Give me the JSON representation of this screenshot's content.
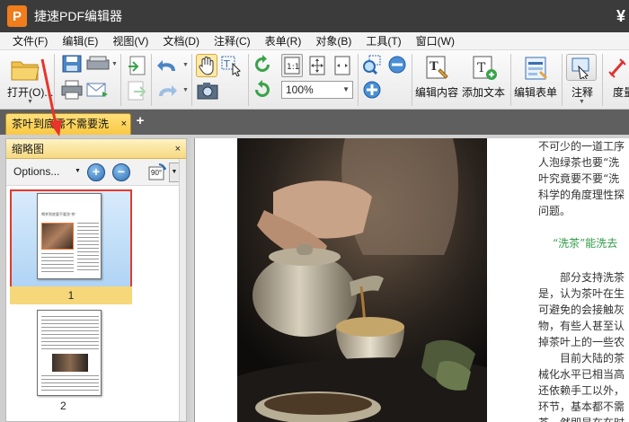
{
  "app": {
    "title": "捷速PDF编辑器",
    "logo_letter": "P",
    "windows_logo": "¥"
  },
  "menu": [
    "文件(F)",
    "编辑(E)",
    "视图(V)",
    "文档(D)",
    "注释(C)",
    "表单(R)",
    "对象(B)",
    "工具(T)",
    "窗口(W)"
  ],
  "toolbar": {
    "open_label": "打开(O)...",
    "zoom_value": "100%",
    "edit_content_label": "编辑内容",
    "add_text_label": "添加文本",
    "edit_form_label": "编辑表单",
    "annotate_label": "注释",
    "measure_label": "度量"
  },
  "tabs": {
    "doc_tab_label": "茶叶到底需不需要洗",
    "close_symbol": "×",
    "add_symbol": "+"
  },
  "thumbnail_panel": {
    "title": "缩略图",
    "close_symbol": "×",
    "options_label": "Options...",
    "zoom_in": "+",
    "zoom_out": "−",
    "rotate_label": "90°",
    "thumbnails": [
      {
        "page": "1",
        "selected": true,
        "heading": "喝茶到底要不要洗“茶”"
      },
      {
        "page": "2",
        "selected": false
      }
    ]
  },
  "document": {
    "lines_top": [
      "不可少的一道工序",
      "人泡绿茶也要“洗",
      "叶究竟要不要“洗",
      "科学的角度理性探",
      "问题。"
    ],
    "heading": "“洗茶”能洗去",
    "lines_bottom": [
      "部分支持洗茶",
      "是，认为茶叶在生",
      "可避免的会接触灰",
      "物，有些人甚至认",
      "掉茶叶上的一些农",
      "目前大陆的茶",
      "械化水平已相当高",
      "还依赖手工以外，",
      "环节，基本都不需",
      "茶，然即是在在时"
    ]
  },
  "colors": {
    "accent_tab": "#f8c843",
    "selection_border": "#e23a2e",
    "arrow": "#e8342a",
    "heading_green": "#2f9a45"
  }
}
